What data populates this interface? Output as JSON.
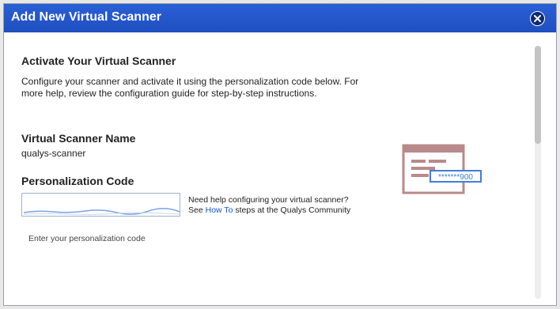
{
  "dialog": {
    "title": "Add New Virtual Scanner",
    "close_icon": "close-icon"
  },
  "activate": {
    "heading": "Activate Your Virtual Scanner",
    "description": "Configure your scanner and activate it using the personalization code below. For more help, review the configuration guide for step-by-step instructions."
  },
  "scanner": {
    "name_label": "Virtual Scanner Name",
    "name_value": "qualys-scanner"
  },
  "code": {
    "label": "Personalization Code",
    "hint": "Enter your personalization code"
  },
  "help": {
    "line1": "Need help configuring your virtual scanner?",
    "line2_prefix": "See ",
    "link": "How To",
    "line2_suffix": " steps at the Qualys Community"
  },
  "illustration": {
    "icon": "scanner-code-illustration",
    "code_text": "*******900",
    "colors": {
      "card": "#b98a8a",
      "code_box": "#3f7fd6"
    }
  },
  "colors": {
    "titlebar": "#2456cc",
    "close_button": "#0d2a78",
    "link": "#1a56c4"
  }
}
